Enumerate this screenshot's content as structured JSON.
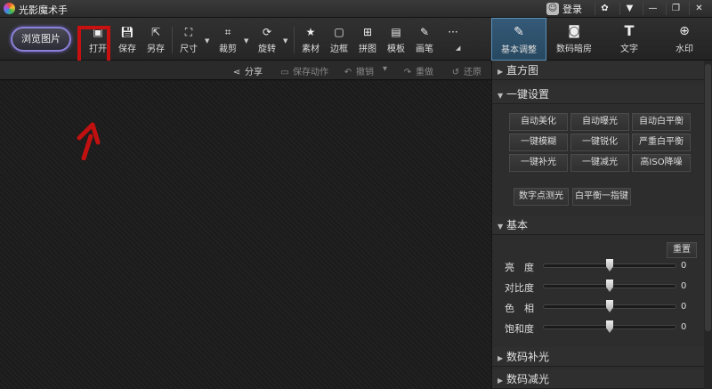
{
  "app": {
    "title": "光影魔术手",
    "login": "登录"
  },
  "toolbar": {
    "browse": "浏览图片",
    "open": "打开",
    "save": "保存",
    "saveas": "另存",
    "size": "尺寸",
    "crop": "裁剪",
    "rotate": "旋转",
    "material": "素材",
    "border": "边框",
    "collage": "拼图",
    "template": "模板",
    "brush": "画笔",
    "more_icon": "more-icon"
  },
  "righttabs": [
    {
      "label": "基本调整",
      "icon": "edit-icon",
      "active": true
    },
    {
      "label": "数码暗房",
      "icon": "camera-icon",
      "active": false
    },
    {
      "label": "文字",
      "icon": "text-icon",
      "active": false
    },
    {
      "label": "水印",
      "icon": "watermark-icon",
      "active": false
    }
  ],
  "actions": {
    "share": "分享",
    "save_action": "保存动作",
    "undo": "撤销",
    "redo": "重做",
    "restore": "还原"
  },
  "panel": {
    "histogram": "直方图",
    "onekey": {
      "title": "一键设置",
      "buttons": [
        "自动美化",
        "自动曝光",
        "自动白平衡",
        "一键模糊",
        "一键锐化",
        "严重白平衡",
        "一键补光",
        "一键减光",
        "高ISO降噪"
      ],
      "extra": [
        "数字点测光",
        "白平衡一指键"
      ]
    },
    "basic": {
      "title": "基本",
      "reset": "重置",
      "sliders": [
        {
          "label": "亮　度",
          "value": "0",
          "level": 0.5
        },
        {
          "label": "对比度",
          "value": "0",
          "level": 0.5
        },
        {
          "label": "色　相",
          "value": "0",
          "level": 0.5
        },
        {
          "label": "饱和度",
          "value": "0",
          "level": 0.5
        }
      ]
    },
    "fill_light": "数码补光",
    "reduce_light": "数码减光"
  },
  "colors": {
    "accent": "#c81010",
    "active_tab": "#355a78",
    "browse_glow": "#8b82d8"
  }
}
